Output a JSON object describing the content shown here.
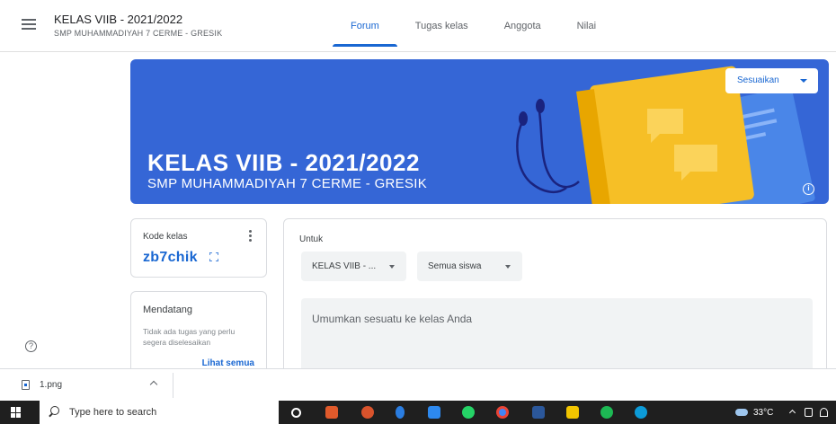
{
  "header": {
    "class_title": "KELAS VIIB - 2021/2022",
    "class_subtitle": "SMP MUHAMMADIYAH 7 CERME - GRESIK",
    "tabs": [
      {
        "label": "Forum",
        "active": true
      },
      {
        "label": "Tugas kelas",
        "active": false
      },
      {
        "label": "Anggota",
        "active": false
      },
      {
        "label": "Nilai",
        "active": false
      }
    ]
  },
  "banner": {
    "title": "KELAS VIIB - 2021/2022",
    "subtitle": "SMP MUHAMMADIYAH 7 CERME - GRESIK",
    "customize_label": "Sesuaikan",
    "color": "#3566d6"
  },
  "class_code": {
    "label": "Kode kelas",
    "value": "zb7chik"
  },
  "upcoming": {
    "title": "Mendatang",
    "empty_text": "Tidak ada tugas yang perlu segera diselesaikan",
    "view_all": "Lihat semua"
  },
  "post": {
    "for_label": "Untuk",
    "class_select": "KELAS VIIB - ...",
    "students_select": "Semua siswa",
    "announce_placeholder": "Umumkan sesuatu ke kelas Anda"
  },
  "downloads": {
    "file_name": "1.png"
  },
  "taskbar": {
    "search_placeholder": "Type here to search",
    "weather": "33°C"
  },
  "colors": {
    "accent": "#1967d2",
    "banner": "#3566d6"
  }
}
